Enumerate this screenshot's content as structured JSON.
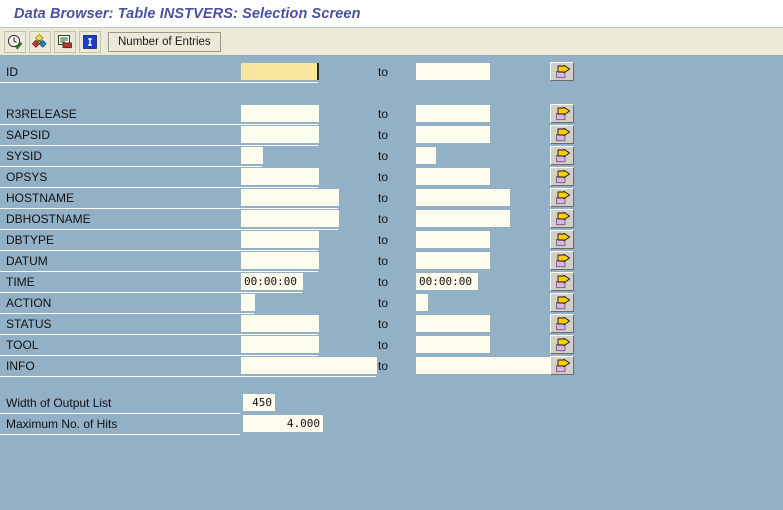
{
  "window": {
    "title": "Data Browser: Table INSTVERS: Selection Screen"
  },
  "toolbar": {
    "icons": [
      {
        "name": "execute-clock-icon",
        "tooltip": "Execute"
      },
      {
        "name": "dynamic-selections-icon",
        "tooltip": "Dynamic selections"
      },
      {
        "name": "selection-options-icon",
        "tooltip": "Selection options"
      },
      {
        "name": "information-icon",
        "tooltip": "Information"
      }
    ],
    "number_of_entries_label": "Number of Entries"
  },
  "selection": {
    "to_label": "to",
    "arrow_button_title": "Multiple selection",
    "rows": [
      {
        "label": "ID",
        "from": "",
        "to": "",
        "from_w": 78,
        "to_w": 74,
        "focused": true
      },
      {
        "label": "R3RELEASE",
        "from": "",
        "to": "",
        "from_w": 78,
        "to_w": 74,
        "focused": false
      },
      {
        "label": "SAPSID",
        "from": "",
        "to": "",
        "from_w": 78,
        "to_w": 74,
        "focused": false
      },
      {
        "label": "SYSID",
        "from": "",
        "to": "",
        "from_w": 22,
        "to_w": 20,
        "focused": false
      },
      {
        "label": "OPSYS",
        "from": "",
        "to": "",
        "from_w": 78,
        "to_w": 74,
        "focused": false
      },
      {
        "label": "HOSTNAME",
        "from": "",
        "to": "",
        "from_w": 98,
        "to_w": 94,
        "focused": false
      },
      {
        "label": "DBHOSTNAME",
        "from": "",
        "to": "",
        "from_w": 98,
        "to_w": 94,
        "focused": false
      },
      {
        "label": "DBTYPE",
        "from": "",
        "to": "",
        "from_w": 78,
        "to_w": 74,
        "focused": false
      },
      {
        "label": "DATUM",
        "from": "",
        "to": "",
        "from_w": 78,
        "to_w": 74,
        "focused": false
      },
      {
        "label": "TIME",
        "from": "00:00:00",
        "to": "00:00:00",
        "from_w": 62,
        "to_w": 62,
        "focused": false
      },
      {
        "label": "ACTION",
        "from": "",
        "to": "",
        "from_w": 14,
        "to_w": 12,
        "focused": false
      },
      {
        "label": "STATUS",
        "from": "",
        "to": "",
        "from_w": 78,
        "to_w": 74,
        "focused": false
      },
      {
        "label": "TOOL",
        "from": "",
        "to": "",
        "from_w": 78,
        "to_w": 74,
        "focused": false
      },
      {
        "label": "INFO",
        "from": "",
        "to": "",
        "from_w": 136,
        "to_w": 136,
        "focused": false
      }
    ]
  },
  "output_options": {
    "width_label": "Width of Output List",
    "width_value": "450",
    "max_hits_label": "Maximum No. of Hits",
    "max_hits_value": "4.000"
  },
  "colors": {
    "background": "#93b1c6",
    "field": "#fdfced",
    "field_focused": "#fbe6a0",
    "title_text": "#4a52a0",
    "toolbar": "#ece9d8",
    "arrow_glyph": "#ffcc00"
  }
}
